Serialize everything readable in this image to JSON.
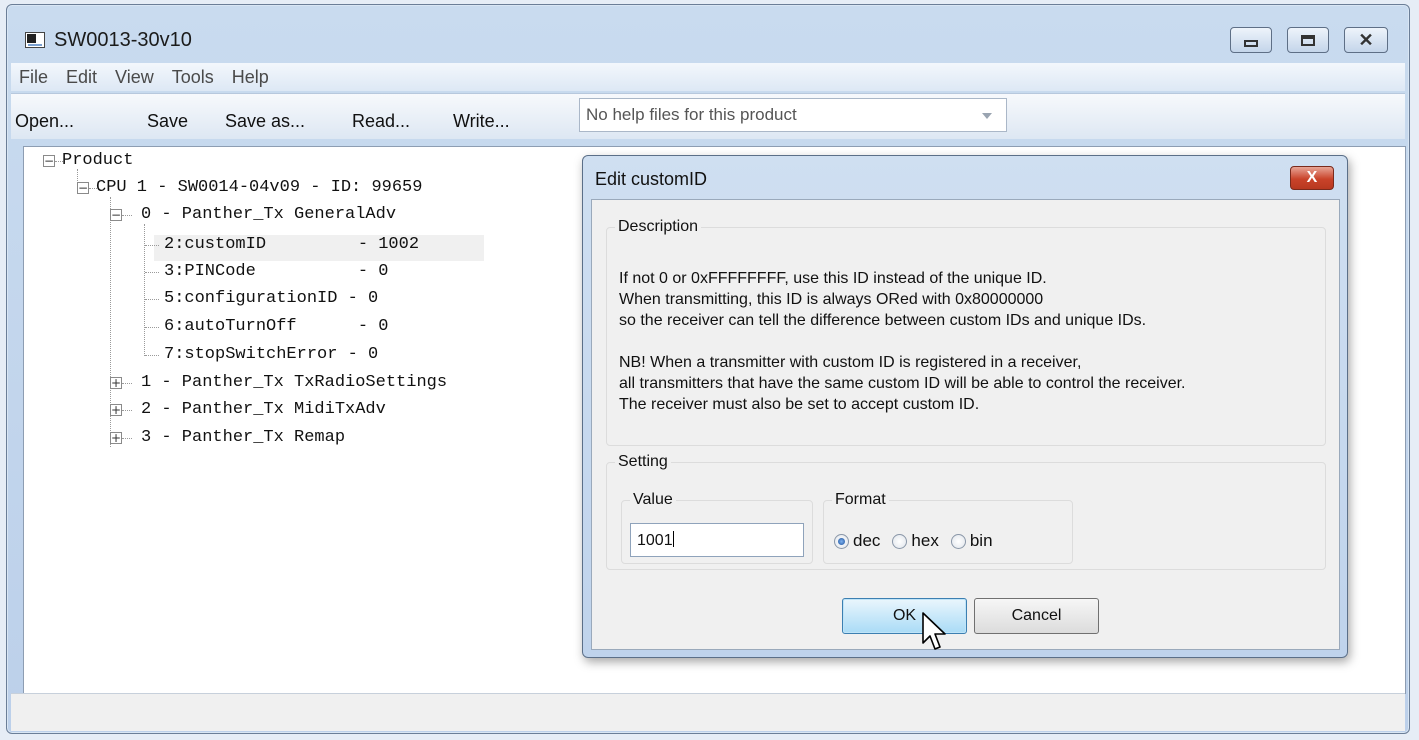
{
  "window": {
    "title": "SW0013-30v10",
    "controls": {
      "minimize": "minimize",
      "maximize": "maximize",
      "close": "close"
    }
  },
  "menu": [
    "File",
    "Edit",
    "View",
    "Tools",
    "Help"
  ],
  "toolbar": {
    "open": "Open...",
    "save": "Save",
    "save_as": "Save as...",
    "read": "Read...",
    "write": "Write...",
    "help_combo": "No help files for this product"
  },
  "tree": {
    "root": "Product",
    "cpu": "CPU 1 - SW0014-04v09 - ID: 99659",
    "groups": [
      {
        "label": "0 - Panther_Tx GeneralAdv",
        "expanded": true,
        "items": [
          "2:customID         - 1002",
          "3:PINCode          - 0",
          "5:configurationID - 0",
          "6:autoTurnOff      - 0",
          "7:stopSwitchError - 0"
        ]
      },
      {
        "label": "1 - Panther_Tx TxRadioSettings",
        "expanded": false
      },
      {
        "label": "2 - Panther_Tx MidiTxAdv",
        "expanded": false
      },
      {
        "label": "3 - Panther_Tx Remap",
        "expanded": false
      }
    ],
    "selected_index": 0
  },
  "dialog": {
    "title": "Edit customID",
    "close": "X",
    "description_legend": "Description",
    "description_lines": [
      "If not 0 or 0xFFFFFFFF, use this ID instead of the unique ID.",
      "When transmitting, this ID is always ORed with 0x80000000",
      "so the receiver can tell the difference between custom IDs and unique IDs.",
      "",
      "NB! When a transmitter with custom ID is registered in a receiver,",
      "all transmitters that have the same custom ID will be able to control the receiver.",
      "The receiver must also be set to accept custom ID."
    ],
    "setting_legend": "Setting",
    "value_legend": "Value",
    "value": "1001",
    "format_legend": "Format",
    "format_options": [
      "dec",
      "hex",
      "bin"
    ],
    "format_selected": "dec",
    "ok": "OK",
    "cancel": "Cancel"
  },
  "icons": {
    "app": "app-window-icon",
    "cursor": "mouse-pointer-icon"
  },
  "colors": {
    "frame": "#bcd0ea",
    "dialog_close": "#c9432a",
    "radio_selected": "#1a4f9a",
    "ok_button": "#a9dbf6"
  }
}
